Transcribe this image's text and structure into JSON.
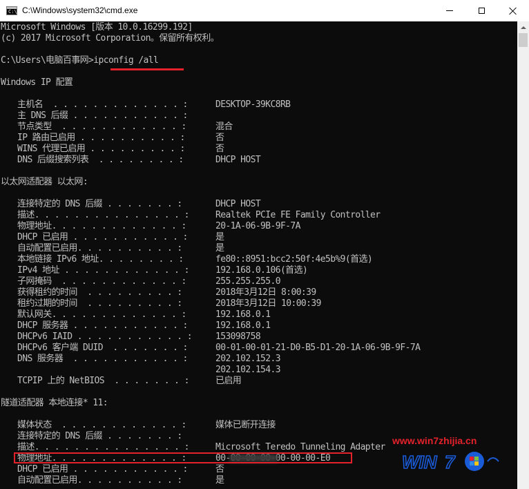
{
  "window": {
    "title": "C:\\Windows\\system32\\cmd.exe",
    "icon": "cmd-icon",
    "controls": [
      "minimize-icon",
      "maximize-icon",
      "close-icon"
    ]
  },
  "console": {
    "header": [
      "Microsoft Windows [版本 10.0.16299.192]",
      "(c) 2017 Microsoft Corporation。保留所有权利。"
    ],
    "prompt": "C:\\Users\\电脑百事网>",
    "command": "ipconfig /all",
    "windows_ip_title": "Windows IP 配置",
    "windows_ip_rows": [
      {
        "label": "主机名  . . . . . . . . . . . . . :",
        "value": "DESKTOP-39KC8RB"
      },
      {
        "label": "主 DNS 后缀 . . . . . . . . . . . :",
        "value": ""
      },
      {
        "label": "节点类型  . . . . . . . . . . . . :",
        "value": "混合"
      },
      {
        "label": "IP 路由已启用 . . . . . . . . . . :",
        "value": "否"
      },
      {
        "label": "WINS 代理已启用 . . . . . . . . . :",
        "value": "否"
      },
      {
        "label": "DNS 后缀搜索列表  . . . . . . . . :",
        "value": "DHCP HOST"
      }
    ],
    "ethernet_title": "以太网适配器 以太网:",
    "ethernet_rows": [
      {
        "label": "连接特定的 DNS 后缀 . . . . . . . :",
        "value": "DHCP HOST"
      },
      {
        "label": "描述. . . . . . . . . . . . . . . :",
        "value": "Realtek PCIe FE Family Controller"
      },
      {
        "label": "物理地址. . . . . . . . . . . . . :",
        "value": "20-1A-06-9B-9F-7A"
      },
      {
        "label": "DHCP 已启用 . . . . . . . . . . . :",
        "value": "是"
      },
      {
        "label": "自动配置已启用. . . . . . . . . . :",
        "value": "是"
      },
      {
        "label": "本地链接 IPv6 地址. . . . . . . . :",
        "value": "fe80::8951:bcc2:50f:4e5b%9(首选)"
      },
      {
        "label": "IPv4 地址 . . . . . . . . . . . . :",
        "value": "192.168.0.106(首选)"
      },
      {
        "label": "子网掩码  . . . . . . . . . . . . :",
        "value": "255.255.255.0"
      },
      {
        "label": "获得租约的时间  . . . . . . . . . :",
        "value": "2018年3月12日 8:00:39"
      },
      {
        "label": "租约过期的时间  . . . . . . . . . :",
        "value": "2018年3月12日 10:00:39"
      },
      {
        "label": "默认网关. . . . . . . . . . . . . :",
        "value": "192.168.0.1"
      },
      {
        "label": "DHCP 服务器 . . . . . . . . . . . :",
        "value": "192.168.0.1"
      },
      {
        "label": "DHCPv6 IAID . . . . . . . . . . . :",
        "value": "153098758"
      },
      {
        "label": "DHCPv6 客户端 DUID  . . . . . . . :",
        "value": "00-01-00-01-21-D0-B5-D1-20-1A-06-9B-9F-7A"
      },
      {
        "label": "DNS 服务器  . . . . . . . . . . . :",
        "value": "202.102.152.3"
      },
      {
        "label": "",
        "value": "202.102.154.3"
      },
      {
        "label": "TCPIP 上的 NetBIOS  . . . . . . . :",
        "value": "已启用"
      }
    ],
    "tunnel_title": "隧道适配器 本地连接* 11:",
    "tunnel_rows": [
      {
        "label": "媒体状态  . . . . . . . . . . . . :",
        "value": "媒体已断开连接"
      },
      {
        "label": "连接特定的 DNS 后缀 . . . . . . . :",
        "value": ""
      },
      {
        "label": "描述. . . . . . . . . . . . . . . :",
        "value": "Microsoft Teredo Tunneling Adapter"
      },
      {
        "label": "物理地址. . . . . . . . . . . . . :",
        "value": "00-00-00-00-00-00-00-E0"
      },
      {
        "label": "DHCP 已启用 . . . . . . . . . . . :",
        "value": "否"
      },
      {
        "label": "自动配置已启用. . . . . . . . . . :",
        "value": "是"
      }
    ]
  },
  "watermark": {
    "url": "www.win7zhijia.cn",
    "logo_text": "WIN7"
  },
  "colors": {
    "console_bg": "#0c0c0c",
    "console_text": "#c0c0c0",
    "annotation_red": "#e5222b"
  }
}
